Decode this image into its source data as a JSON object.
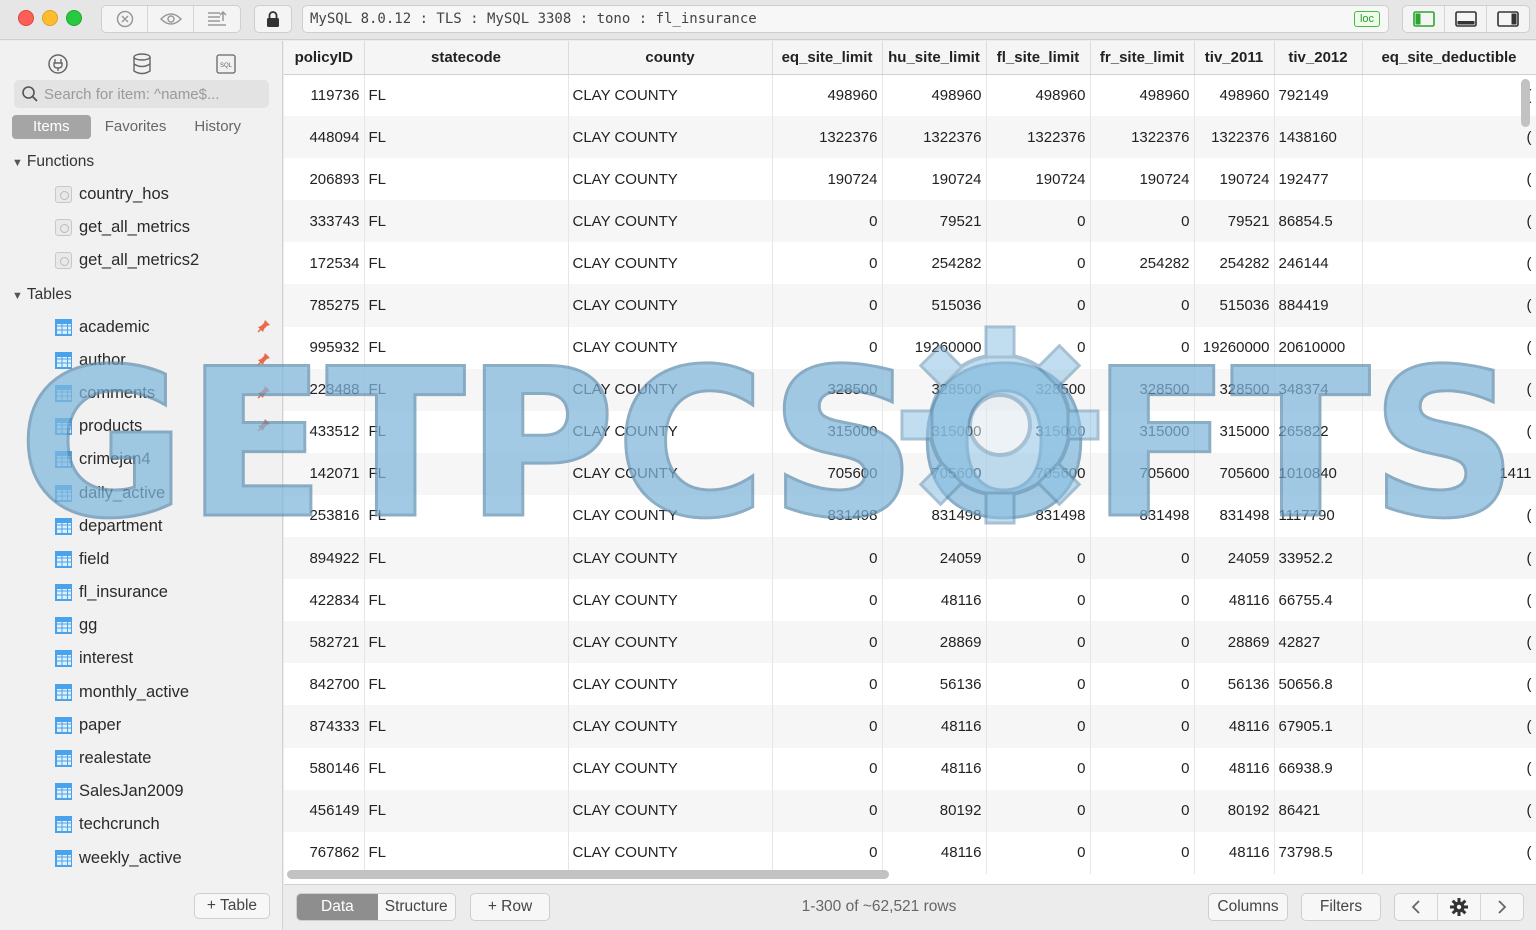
{
  "titlebar": {
    "connection": "MySQL 8.0.12 : TLS : MySQL 3308 : tono : fl_insurance",
    "badge": "loc"
  },
  "sidebar": {
    "search_placeholder": "Search for item: ^name$...",
    "tabs": [
      "Items",
      "Favorites",
      "History"
    ],
    "functions_label": "Functions",
    "functions": [
      "country_hos",
      "get_all_metrics",
      "get_all_metrics2"
    ],
    "tables_label": "Tables",
    "tables": [
      {
        "name": "academic",
        "pinned": true
      },
      {
        "name": "author",
        "pinned": true
      },
      {
        "name": "comments",
        "pinned": true
      },
      {
        "name": "products",
        "pinned": true
      },
      {
        "name": "crimejan4",
        "pinned": false
      },
      {
        "name": "daily_active",
        "pinned": false
      },
      {
        "name": "department",
        "pinned": false
      },
      {
        "name": "field",
        "pinned": false
      },
      {
        "name": "fl_insurance",
        "pinned": false
      },
      {
        "name": "gg",
        "pinned": false
      },
      {
        "name": "interest",
        "pinned": false
      },
      {
        "name": "monthly_active",
        "pinned": false
      },
      {
        "name": "paper",
        "pinned": false
      },
      {
        "name": "realestate",
        "pinned": false
      },
      {
        "name": "SalesJan2009",
        "pinned": false
      },
      {
        "name": "techcrunch",
        "pinned": false
      },
      {
        "name": "weekly_active",
        "pinned": false
      }
    ],
    "add_table_label": "+ Table"
  },
  "grid": {
    "columns": [
      "policyID",
      "statecode",
      "county",
      "eq_site_limit",
      "hu_site_limit",
      "fl_site_limit",
      "fr_site_limit",
      "tiv_2011",
      "tiv_2012",
      "eq_site_deductible"
    ],
    "rows": [
      [
        "119736",
        "FL",
        "CLAY COUNTY",
        "498960",
        "498960",
        "498960",
        "498960",
        "498960",
        "792149",
        "("
      ],
      [
        "448094",
        "FL",
        "CLAY COUNTY",
        "1322376",
        "1322376",
        "1322376",
        "1322376",
        "1322376",
        "1438160",
        "("
      ],
      [
        "206893",
        "FL",
        "CLAY COUNTY",
        "190724",
        "190724",
        "190724",
        "190724",
        "190724",
        "192477",
        "("
      ],
      [
        "333743",
        "FL",
        "CLAY COUNTY",
        "0",
        "79521",
        "0",
        "0",
        "79521",
        "86854.5",
        "("
      ],
      [
        "172534",
        "FL",
        "CLAY COUNTY",
        "0",
        "254282",
        "0",
        "254282",
        "254282",
        "246144",
        "("
      ],
      [
        "785275",
        "FL",
        "CLAY COUNTY",
        "0",
        "515036",
        "0",
        "0",
        "515036",
        "884419",
        "("
      ],
      [
        "995932",
        "FL",
        "CLAY COUNTY",
        "0",
        "19260000",
        "0",
        "0",
        "19260000",
        "20610000",
        "("
      ],
      [
        "223488",
        "FL",
        "CLAY COUNTY",
        "328500",
        "328500",
        "328500",
        "328500",
        "328500",
        "348374",
        "("
      ],
      [
        "433512",
        "FL",
        "CLAY COUNTY",
        "315000",
        "315000",
        "315000",
        "315000",
        "315000",
        "265822",
        "("
      ],
      [
        "142071",
        "FL",
        "CLAY COUNTY",
        "705600",
        "705600",
        "705600",
        "705600",
        "705600",
        "1010840",
        "1411"
      ],
      [
        "253816",
        "FL",
        "CLAY COUNTY",
        "831498",
        "831498",
        "831498",
        "831498",
        "831498",
        "1117790",
        "("
      ],
      [
        "894922",
        "FL",
        "CLAY COUNTY",
        "0",
        "24059",
        "0",
        "0",
        "24059",
        "33952.2",
        "("
      ],
      [
        "422834",
        "FL",
        "CLAY COUNTY",
        "0",
        "48116",
        "0",
        "0",
        "48116",
        "66755.4",
        "("
      ],
      [
        "582721",
        "FL",
        "CLAY COUNTY",
        "0",
        "28869",
        "0",
        "0",
        "28869",
        "42827",
        "("
      ],
      [
        "842700",
        "FL",
        "CLAY COUNTY",
        "0",
        "56136",
        "0",
        "0",
        "56136",
        "50656.8",
        "("
      ],
      [
        "874333",
        "FL",
        "CLAY COUNTY",
        "0",
        "48116",
        "0",
        "0",
        "48116",
        "67905.1",
        "("
      ],
      [
        "580146",
        "FL",
        "CLAY COUNTY",
        "0",
        "48116",
        "0",
        "0",
        "48116",
        "66938.9",
        "("
      ],
      [
        "456149",
        "FL",
        "CLAY COUNTY",
        "0",
        "80192",
        "0",
        "0",
        "80192",
        "86421",
        "("
      ],
      [
        "767862",
        "FL",
        "CLAY COUNTY",
        "0",
        "48116",
        "0",
        "0",
        "48116",
        "73798.5",
        "("
      ]
    ]
  },
  "bottombar": {
    "tabs": [
      "Data",
      "Structure"
    ],
    "add_row_label": "+ Row",
    "rows_info": "1-300 of ~62,521 rows",
    "columns_label": "Columns",
    "filters_label": "Filters"
  },
  "watermark": {
    "text": "GETPCSOFTS"
  }
}
